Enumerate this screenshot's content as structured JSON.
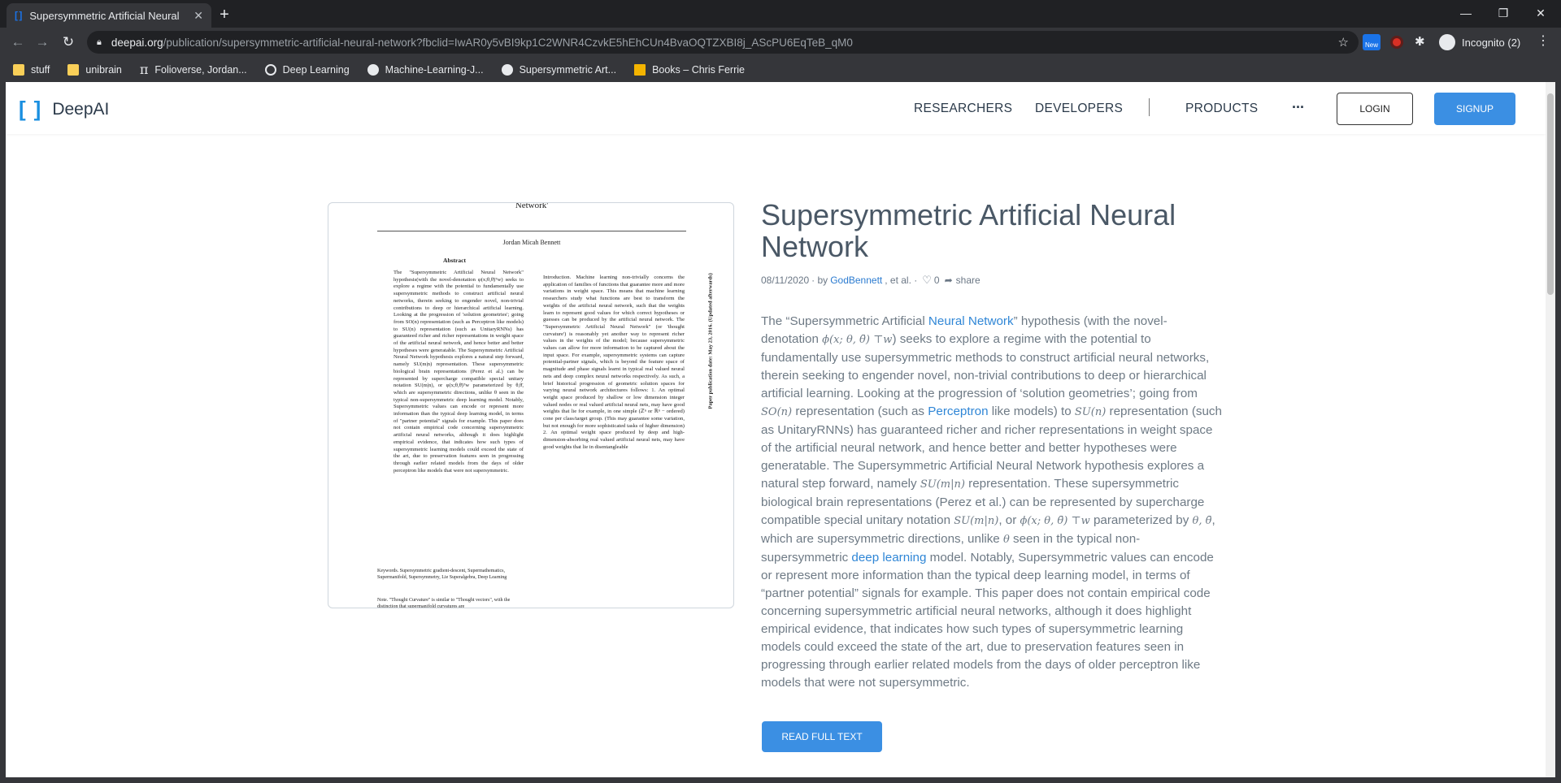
{
  "browser": {
    "tab_title": "Supersymmetric Artificial Neural",
    "tab_favicon": "[ ]",
    "url_domain": "deepai.org",
    "url_path": "/publication/supersymmetric-artificial-neural-network?fbclid=IwAR0y5vBI9kp1C2WNR4CzvkE5hEhCUn4BvaOQTZXBI8j_AScPU6EqTeB_qM0",
    "ext_new_label": "New",
    "profile_label": "Incognito (2)",
    "bookmarks": [
      {
        "label": "stuff",
        "icon": "folder-icon"
      },
      {
        "label": "unibrain",
        "icon": "folder-icon"
      },
      {
        "label": "Folioverse, Jordan...",
        "icon": "pi-icon"
      },
      {
        "label": "Deep Learning",
        "icon": "globe-icon"
      },
      {
        "label": "Machine-Learning-J...",
        "icon": "github-icon"
      },
      {
        "label": "Supersymmetric Art...",
        "icon": "github-icon"
      },
      {
        "label": "Books – Chris Ferrie",
        "icon": "book-icon"
      }
    ]
  },
  "site": {
    "logo_text": "DeepAI",
    "nav": {
      "researchers": "RESEARCHERS",
      "developers": "DEVELOPERS",
      "products": "PRODUCTS",
      "more": "..."
    },
    "login_label": "LOGIN",
    "signup_label": "SIGNUP",
    "accent_color": "#3b8fe3"
  },
  "preview": {
    "title_line": "Network'",
    "author": "Jordan Micah Bennett",
    "abstract_heading": "Abstract",
    "left_column": "The \"Supersymmetric Artificial Neural Network\" hypothesis(with the novel-denotation φ(x;θ,θ̄)ᵀw) seeks to explore a regime with the potential to fundamentally use supersymmetric methods to construct artificial neural networks, therein seeking to engender novel, non-trivial contributions to deep or hierarchical artificial learning. Looking at the progression of 'solution geometries'; going from SO(n) representation (such as Perceptron like models) to SU(n) representation (such as UnitaryRNNs) has guaranteed richer and richer representations in weight space of the artificial neural network, and hence better and better hypotheses were generatable. The Supersymmetric Artificial Neural Network hypothesis explores a natural step forward, namely SU(m|n) representation. These supersymmetric biological brain representations (Perez et al.) can be represented by supercharge compatible special unitary notation SU(m|n), or φ(x;θ,θ̄)ᵀw parameterized by θ,θ̄, which are supersymmetric directions, unlike θ seen in the typical non-supersymmetric deep learning model. Notably, Supersymmetric values can encode or represent more information than the typical deep learning model, in terms of \"partner potential\" signals for example. This paper does not contain empirical code concerning supersymmetric artificial neural networks, although it does highlight empirical evidence, that indicates how such types of supersymmetric learning models could exceed the state of the art, due to preservation features seen in progressing through earlier related models from the days of older perceptron like models that were not supersymmetric.",
    "right_column": "Introduction. Machine learning non-trivially concerns the application of families of functions that guarantee more and more variations in weight space. This means that machine learning researchers study what functions are best to transform the weights of the artificial neural network, such that the weights learn to represent good values for which correct hypotheses or guesses can be produced by the artificial neural network. The \"Supersymmetric Artificial Neural Network\" (or 'thought curvature') is reasonably yet another way to represent richer values in the weights of the model; because supersymmetric values can allow for more information to be captured about the input space. For example, supersymmetric systems can capture potential-partner signals, which is beyond the feature space of magnitude and phase signals learnt in typical real valued neural nets and deep complex neural networks respectively. As such, a brief historical progression of geometric solution spaces for varying neural network architectures follows: 1. An optimal weight space produced by shallow or low dimension integer valued nodes or real valued artificial neural nets, may have good weights that lie for example, in one simple (ℤⁿ or ℝⁿ − ordered) cone per class/target group. (This may guarantee some variation, but not enough for more sophisticated tasks of higher dimension) 2. An optimal weight space produced by deep and high-dimension-absorbing real valued artificial neural nets, may have good weights that lie in disentangleable",
    "side_label": "Paper publication date: May 23, 2016. (Updated afterwards)",
    "keywords": "Keywords. Supersymmetric gradient-descent, Supermathematics, Supermanifold, Supersymmetry, Lie Superalgebra, Deep Learning",
    "note": "Note. \"Thought Curvature\" is similar to \"Thought vectors\", with the distinction that supermanifold curvatures are"
  },
  "article": {
    "title": "Supersymmetric Artificial Neural Network",
    "date": "08/11/2020",
    "by_label": "· by",
    "author": "GodBennett",
    "et_al": ", et al. ·",
    "likes": "0",
    "share_label": "share",
    "abstract": {
      "p1": "The “Supersymmetric Artificial ",
      "link_neural_network": "Neural Network",
      "p2": "” hypothesis (with the novel-denotation ",
      "math_phi1": "ϕ(x; θ, θ̄) ⊤w",
      "p3": ") seeks to explore a regime with the potential to fundamentally use supersymmetric methods to construct artificial neural networks, therein seeking to engender novel, non-trivial contributions to deep or hierarchical artificial learning. Looking at the progression of ‘solution geometries’; going from ",
      "math_so": "SO(n)",
      "p4": " representation (such as ",
      "link_perceptron": "Perceptron",
      "p5": " like models) to ",
      "math_su": "SU(n)",
      "p6": " representation (such as UnitaryRNNs) has guaranteed richer and richer representations in weight space of the artificial neural network, and hence better and better hypotheses were generatable. The Supersymmetric Artificial Neural Network hypothesis explores a natural step forward, namely ",
      "math_sumn1": "SU(m|n)",
      "p7": " representation. These supersymmetric biological brain representations (Perez et al.) can be represented by supercharge compatible special unitary notation ",
      "math_sumn2": "SU(m|n)",
      "p8": ", or ",
      "math_phi2": "ϕ(x; θ, θ̄) ⊤w",
      "p9": " parameterized by ",
      "math_theta": "θ, θ̄",
      "p10": ", which are supersymmetric directions, unlike ",
      "math_theta2": "θ",
      "p11": " seen in the typical non-supersymmetric ",
      "link_deep_learning": "deep learning",
      "p12": " model. Notably, Supersymmetric values can encode or represent more information than the typical deep learning model, in terms of “partner potential” signals for example. This paper does not contain empirical code concerning supersymmetric artificial neural networks, although it does highlight empirical evidence, that indicates how such types of supersymmetric learning models could exceed the state of the art, due to preservation features seen in progressing through earlier related models from the days of older perceptron like models that were not supersymmetric."
    },
    "read_button": "READ FULL TEXT"
  }
}
